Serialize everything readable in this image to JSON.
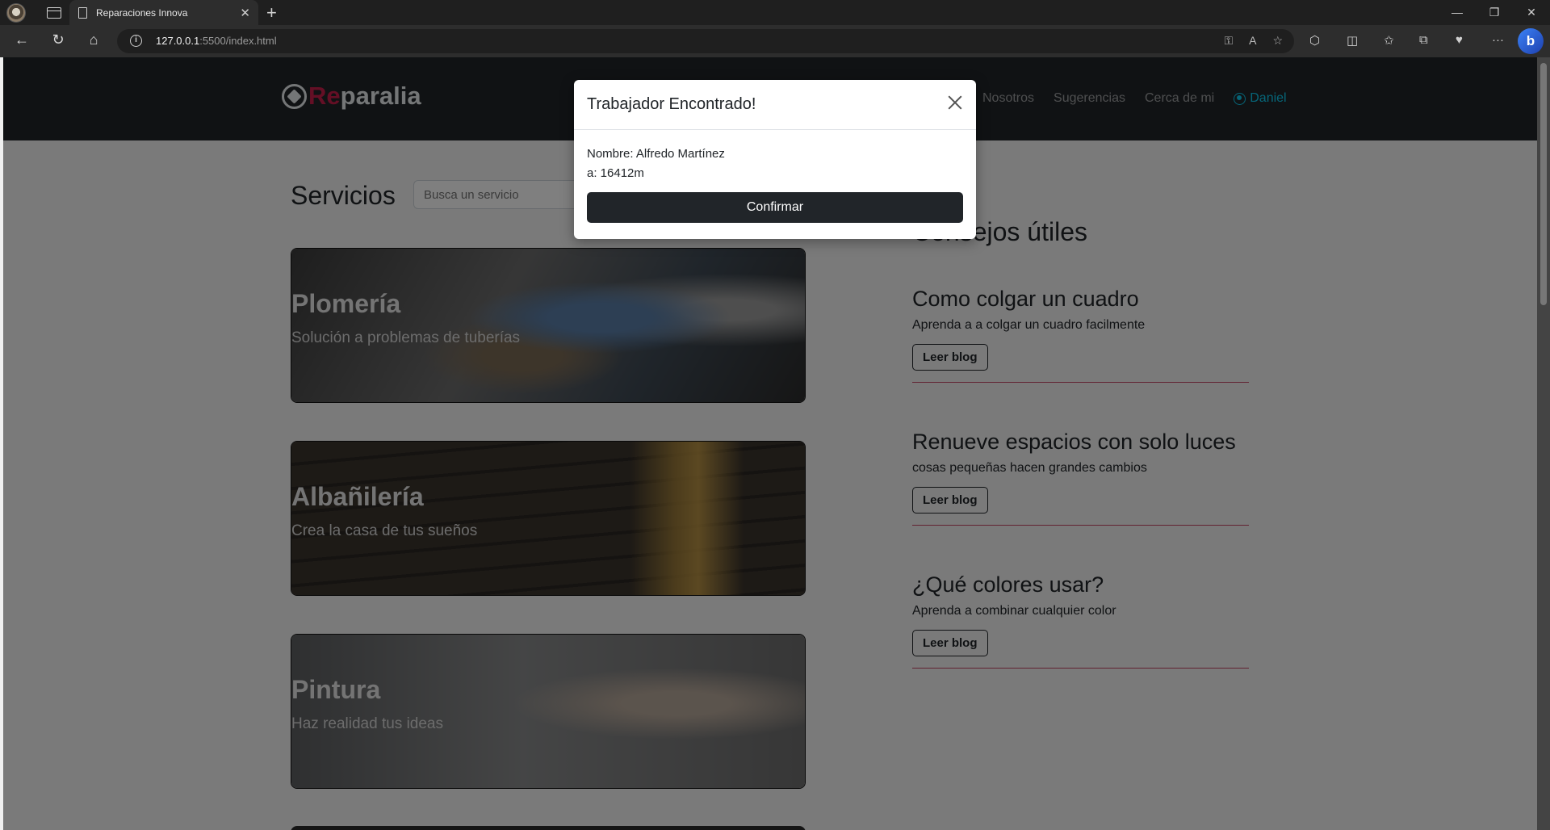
{
  "browser": {
    "tab_title": "Reparaciones Innova",
    "url_host": "127.0.0.1",
    "url_rest": ":5500/index.html"
  },
  "site": {
    "logo_accent": "Re",
    "logo_rest": "paralia",
    "nav": [
      "Nosotros",
      "Sugerencias",
      "Cerca de mi"
    ],
    "user": "Daniel",
    "colors": {
      "navbar": "#212529",
      "accent": "#c81e4a",
      "user": "#0dcaf0"
    }
  },
  "services": {
    "title": "Servicios",
    "search_placeholder": "Busca un servicio",
    "cards": [
      {
        "title": "Plomería",
        "subtitle": "Solución a problemas de tuberías"
      },
      {
        "title": "Albañilería",
        "subtitle": "Crea la casa de tus sueños"
      },
      {
        "title": "Pintura",
        "subtitle": "Haz realidad tus ideas"
      }
    ]
  },
  "tips": {
    "title": "Consejos útiles",
    "items": [
      {
        "title": "Como colgar un cuadro",
        "desc": "Aprenda a a colgar un cuadro facilmente",
        "button": "Leer blog"
      },
      {
        "title": "Renueve espacios con solo luces",
        "desc": "cosas pequeñas hacen grandes cambios",
        "button": "Leer blog"
      },
      {
        "title": "¿Qué colores usar?",
        "desc": "Aprenda a combinar cualquier color",
        "button": "Leer blog"
      }
    ]
  },
  "modal": {
    "title": "Trabajador Encontrado!",
    "name_line": "Nombre: Alfredo Martínez",
    "distance_line": "a: 16412m",
    "confirm": "Confirmar"
  }
}
